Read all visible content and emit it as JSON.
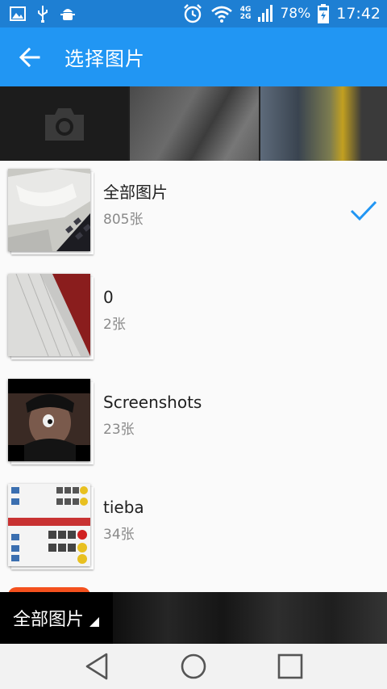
{
  "status_bar": {
    "battery_percent": "78%",
    "time": "17:42",
    "network_badges": [
      "4G",
      "2G"
    ],
    "left_icons": [
      "image-icon",
      "usb-icon",
      "android-debug-icon"
    ],
    "right_icons": [
      "alarm-icon",
      "wifi-icon",
      "signal-icon",
      "battery-charging-icon"
    ]
  },
  "app_bar": {
    "title": "选择图片",
    "back_icon": "arrow-back-icon",
    "color": "#2196f3"
  },
  "folders": [
    {
      "name": "全部图片",
      "count": "805张",
      "selected": true
    },
    {
      "name": "0",
      "count": "2张",
      "selected": false
    },
    {
      "name": "Screenshots",
      "count": "23张",
      "selected": false
    },
    {
      "name": "tieba",
      "count": "34张",
      "selected": false
    }
  ],
  "check_color": "#2196f3",
  "bottom_bar": {
    "album_label": "全部图片"
  },
  "nav_bar": {
    "buttons": [
      "back-icon",
      "home-icon",
      "recents-icon"
    ]
  }
}
